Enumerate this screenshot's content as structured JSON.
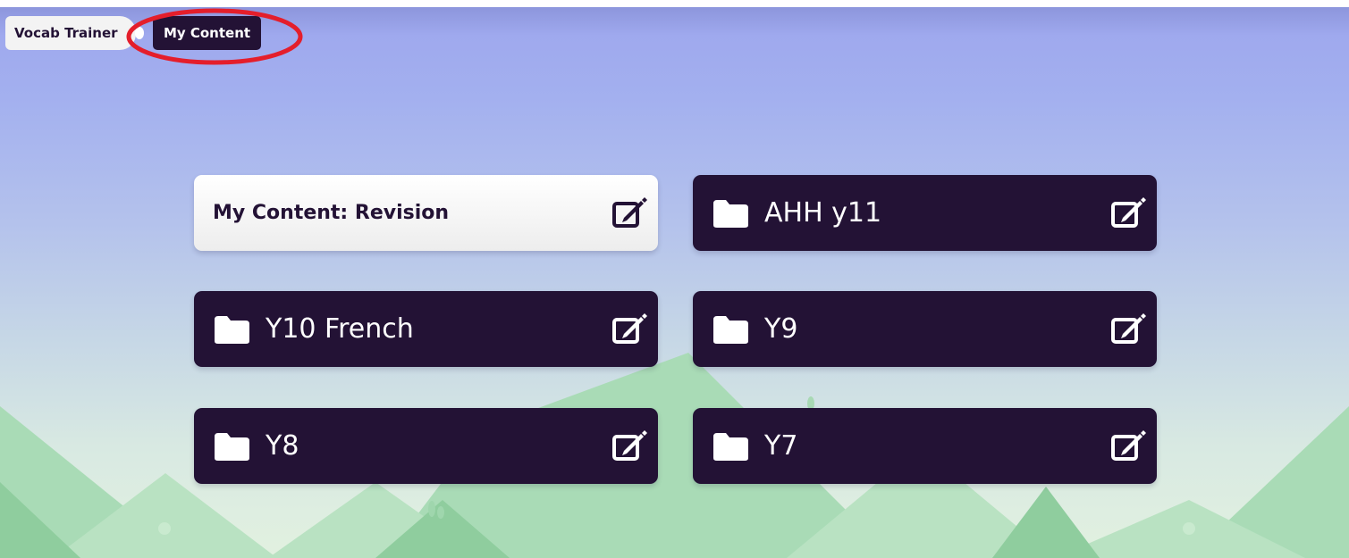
{
  "breadcrumb": {
    "items": [
      {
        "label": "Vocab Trainer"
      },
      {
        "label": "My Content"
      }
    ]
  },
  "cards": [
    {
      "label": "My Content: Revision",
      "style": "light",
      "icon": "edit-icon"
    },
    {
      "label": "AHH y11",
      "style": "dark",
      "icon": "folder-icon"
    },
    {
      "label": "Y10 French",
      "style": "dark",
      "icon": "folder-icon"
    },
    {
      "label": "Y9",
      "style": "dark",
      "icon": "folder-icon"
    },
    {
      "label": "Y8",
      "style": "dark",
      "icon": "folder-icon"
    },
    {
      "label": "Y7",
      "style": "dark",
      "icon": "folder-icon"
    }
  ],
  "colors": {
    "card_dark": "#231235",
    "highlight": "#e41e2b",
    "mountains": "#98d3a8"
  }
}
